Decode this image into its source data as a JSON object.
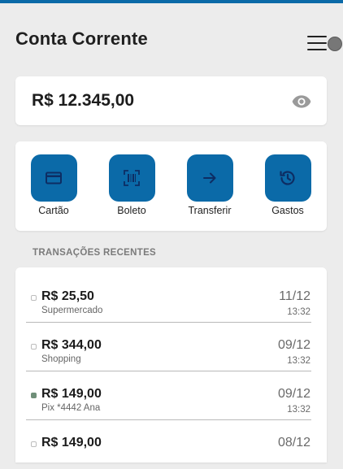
{
  "colors": {
    "brand": "#0b6aa8",
    "background": "#ececec",
    "card": "#ffffff",
    "text_primary": "#1b1b1b",
    "text_secondary": "#6a6a6a",
    "dot_pending": "#bdbdbd",
    "dot_done": "#6f8f78"
  },
  "header": {
    "title": "Conta Corrente",
    "menu_icon": "hamburger-menu-icon",
    "toggle_icon": "toggle-knob-icon"
  },
  "balance": {
    "value": "R$ 12.345,00",
    "visibility_icon": "eye-icon"
  },
  "actions": [
    {
      "label": "Cartão",
      "icon": "credit-card-icon"
    },
    {
      "label": "Boleto",
      "icon": "barcode-scan-icon"
    },
    {
      "label": "Transferir",
      "icon": "arrow-right-icon"
    },
    {
      "label": "Gastos",
      "icon": "history-icon"
    }
  ],
  "transactions": {
    "section_title": "TRANSAÇÕES RECENTES",
    "items": [
      {
        "amount": "R$ 25,50",
        "description": "Supermercado",
        "date": "11/12",
        "time": "13:32",
        "status": "pending"
      },
      {
        "amount": "R$ 344,00",
        "description": "Shopping",
        "date": "09/12",
        "time": "13:32",
        "status": "pending"
      },
      {
        "amount": "R$ 149,00",
        "description": "Pix *4442 Ana",
        "date": "09/12",
        "time": "13:32",
        "status": "done"
      },
      {
        "amount": "R$ 149,00",
        "description": "",
        "date": "08/12",
        "time": "",
        "status": "pending"
      }
    ]
  }
}
